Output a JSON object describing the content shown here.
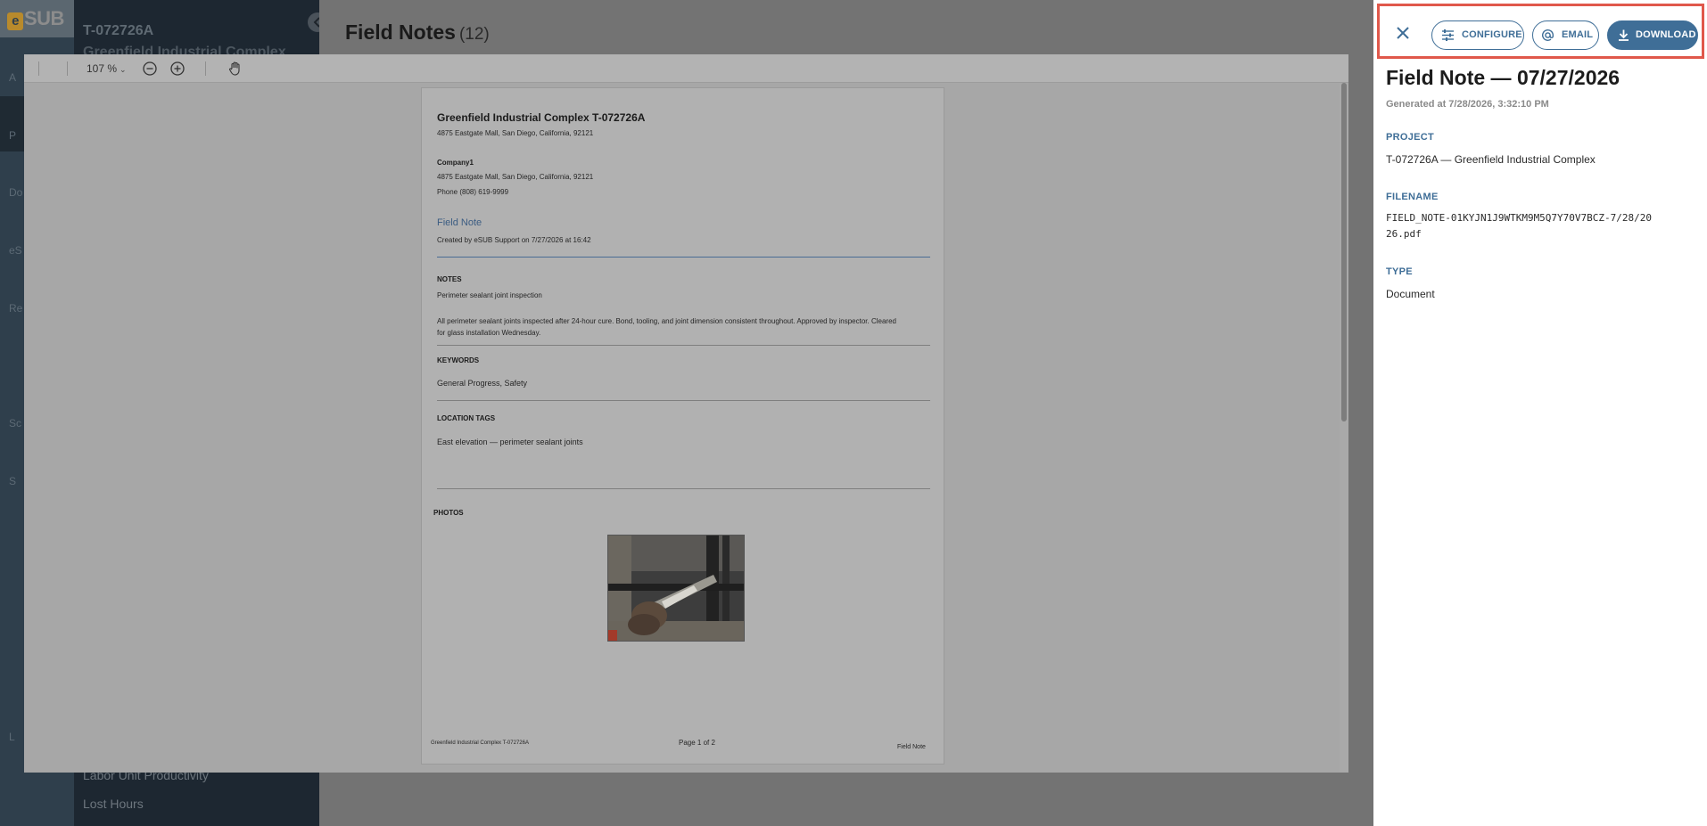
{
  "background_app": {
    "logo_text": "SUB",
    "logo_mark": "e",
    "rail_labels": [
      "A",
      "P",
      "Do",
      "eS",
      "Re",
      "Sc",
      "S",
      "L"
    ],
    "project_code": "T-072726A",
    "project_name": "Greenfield Industrial Complex",
    "nav_items": [
      "Labor Unit Productivity",
      "Lost Hours"
    ],
    "page_title": "Field Notes",
    "page_count": "(12)"
  },
  "viewer": {
    "zoom": "107 %"
  },
  "pdf": {
    "title": "Greenfield Industrial Complex T-072726A",
    "address": "4875 Eastgate Mall, San Diego, California, 92121",
    "company": "Company1",
    "company_address": "4875 Eastgate Mall, San Diego, California, 92121",
    "phone": "Phone (808) 619-9999",
    "doc_type": "Field Note",
    "created_by": "Created by eSUB Support on 7/27/2026 at 16:42",
    "notes_heading": "NOTES",
    "notes_subject": "Perimeter sealant joint inspection",
    "notes_body": "All perimeter sealant joints inspected after 24-hour cure. Bond, tooling, and joint dimension consistent throughout. Approved by inspector. Cleared for glass installation Wednesday.",
    "keywords_heading": "KEYWORDS",
    "keywords": "General Progress, Safety",
    "location_heading": "LOCATION TAGS",
    "location": "East elevation — perimeter sealant joints",
    "photos_heading": "PHOTOS",
    "footer_left": "Greenfield Industrial Complex T-072726A",
    "footer_center": "Page 1 of 2",
    "footer_right": "Field Note"
  },
  "panel": {
    "actions": {
      "configure": "CONFIGURE",
      "email": "EMAIL",
      "download": "DOWNLOAD"
    },
    "title": "Field Note — 07/27/2026",
    "generated": "Generated at 7/28/2026, 3:32:10 PM",
    "project_label": "PROJECT",
    "project_value": "T-072726A — Greenfield Industrial Complex",
    "filename_label": "FILENAME",
    "filename_value": "FIELD_NOTE-01KYJN1J9WTKM9M5Q7Y70V7BCZ-7/28/2026.pdf",
    "type_label": "TYPE",
    "type_value": "Document"
  },
  "colors": {
    "accent": "#3f6e97",
    "highlight_border": "#e0584b"
  }
}
